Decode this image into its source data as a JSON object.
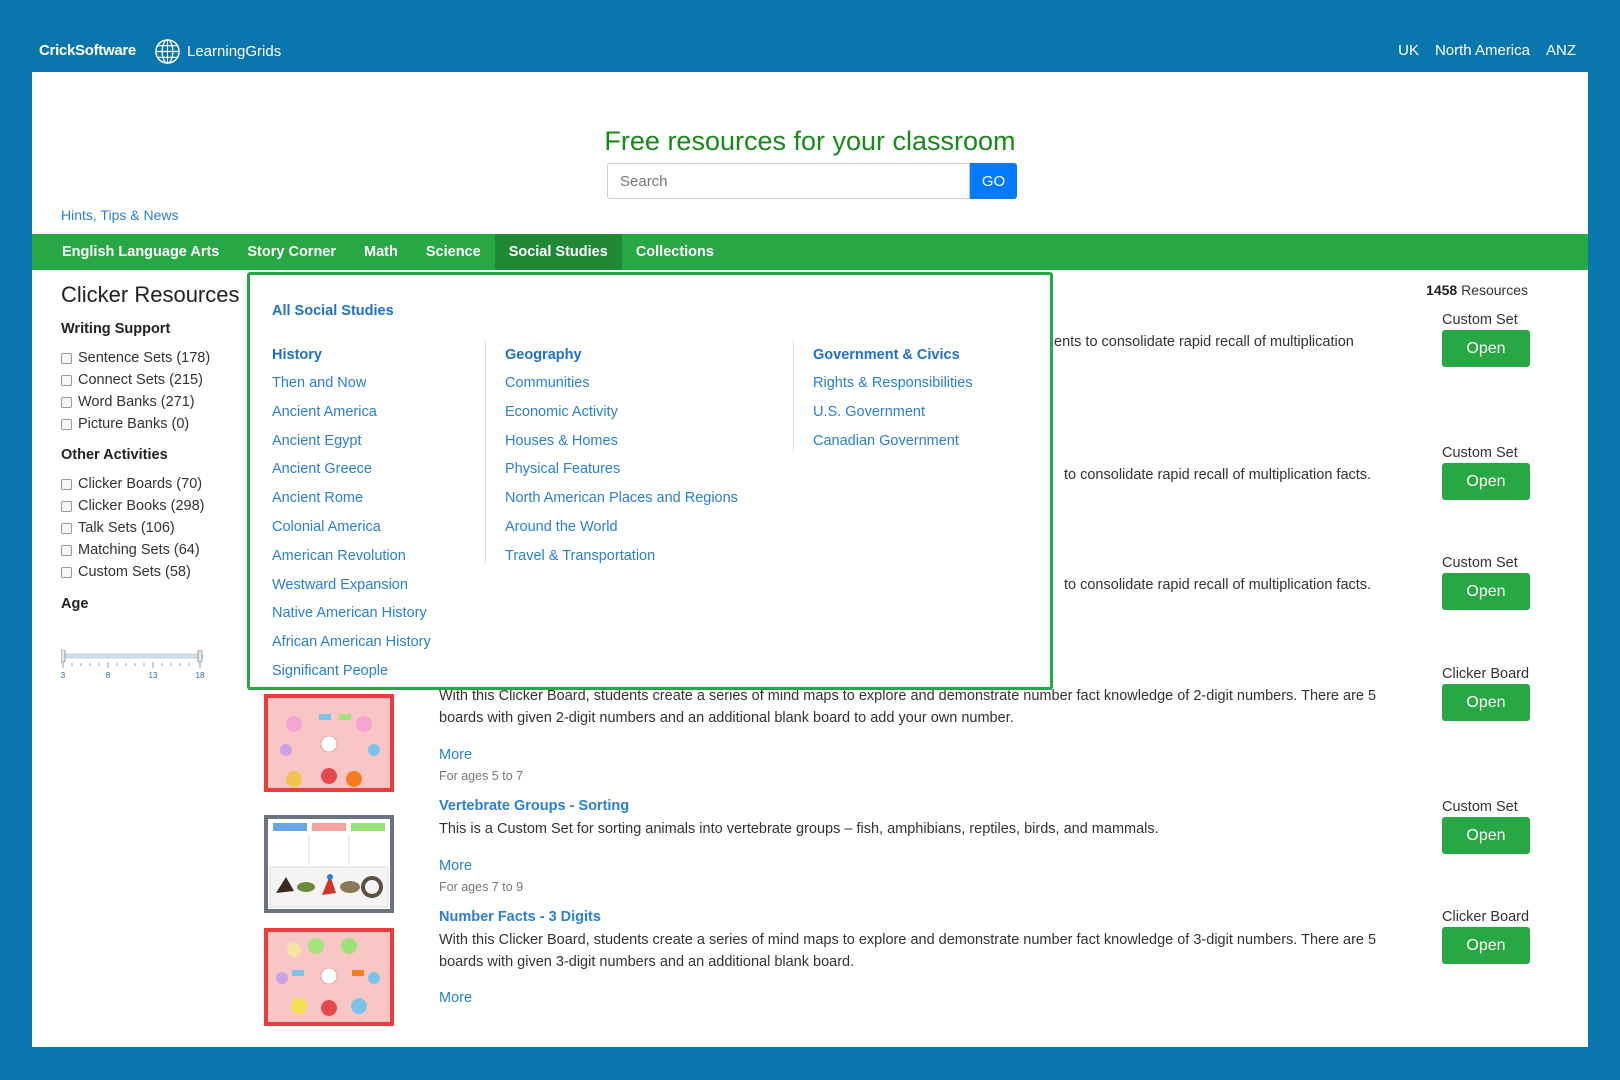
{
  "brand": {
    "crick": "CrickSoftware",
    "learninggrids": "LearningGrids"
  },
  "regions": [
    "UK",
    "North America",
    "ANZ"
  ],
  "hero": {
    "title": "Free resources for your classroom",
    "search_placeholder": "Search",
    "go_label": "GO"
  },
  "hints_link": "Hints, Tips & News",
  "nav": [
    "English Language Arts",
    "Story Corner",
    "Math",
    "Science",
    "Social Studies",
    "Collections"
  ],
  "nav_active": "Social Studies",
  "sidebar": {
    "title": "Clicker Resources",
    "writing_support": {
      "label": "Writing Support",
      "items": [
        "Sentence Sets (178)",
        "Connect Sets (215)",
        "Word Banks (271)",
        "Picture Banks (0)"
      ]
    },
    "other_activities": {
      "label": "Other Activities",
      "items": [
        "Clicker Boards (70)",
        "Clicker Books (298)",
        "Talk Sets (106)",
        "Matching Sets (64)",
        "Custom Sets (58)"
      ]
    },
    "age": {
      "label": "Age",
      "ticks": [
        "3",
        "8",
        "13",
        "18"
      ],
      "range": [
        3,
        18
      ]
    }
  },
  "results": {
    "count_number": "1458",
    "count_label": "Resources",
    "partial_descs": [
      "ents to consolidate rapid recall of multiplication",
      "to consolidate rapid recall of multiplication facts.",
      "to consolidate rapid recall of multiplication facts."
    ],
    "items": [
      {
        "type": "Custom Set",
        "open": "Open"
      },
      {
        "type": "Custom Set",
        "open": "Open"
      },
      {
        "type": "Custom Set",
        "open": "Open"
      },
      {
        "type": "Clicker Board",
        "open": "Open",
        "desc": "With this Clicker Board, students create a series of mind maps to explore and demonstrate number fact knowledge of 2-digit numbers. There are 5 boards with given 2-digit numbers and an additional blank board to add your own number.",
        "more": "More",
        "ages": "For ages 5 to 7"
      },
      {
        "type": "Custom Set",
        "open": "Open",
        "title": "Vertebrate Groups - Sorting",
        "desc": "This is a Custom Set for sorting animals into vertebrate groups – fish, amphibians, reptiles, birds, and mammals.",
        "more": "More",
        "ages": "For ages 7 to 9"
      },
      {
        "type": "Clicker Board",
        "open": "Open",
        "title": "Number Facts - 3 Digits",
        "desc": "With this Clicker Board, students create a series of mind maps to explore and demonstrate number fact knowledge of 3-digit numbers. There are 5 boards with given 3-digit numbers and an additional blank board.",
        "more": "More"
      }
    ]
  },
  "dropdown": {
    "all_label": "All Social Studies",
    "columns": [
      {
        "heading": "History",
        "links": [
          "Then and Now",
          "Ancient America",
          "Ancient Egypt",
          "Ancient Greece",
          "Ancient Rome",
          "Colonial America",
          "American Revolution",
          "Westward Expansion",
          "Native American History",
          "African American History",
          "Significant People"
        ]
      },
      {
        "heading": "Geography",
        "links": [
          "Communities",
          "Economic Activity",
          "Houses & Homes",
          "Physical Features",
          "North American Places and Regions",
          "Around the World",
          "Travel & Transportation"
        ]
      },
      {
        "heading": "Government & Civics",
        "links": [
          "Rights & Responsibilities",
          "U.S. Government",
          "Canadian Government"
        ]
      }
    ]
  },
  "colors": {
    "frame": "#0b76ad",
    "nav": "#28a745",
    "title_green": "#178a1a",
    "link": "#2a7fd4",
    "go": "#007bff"
  }
}
